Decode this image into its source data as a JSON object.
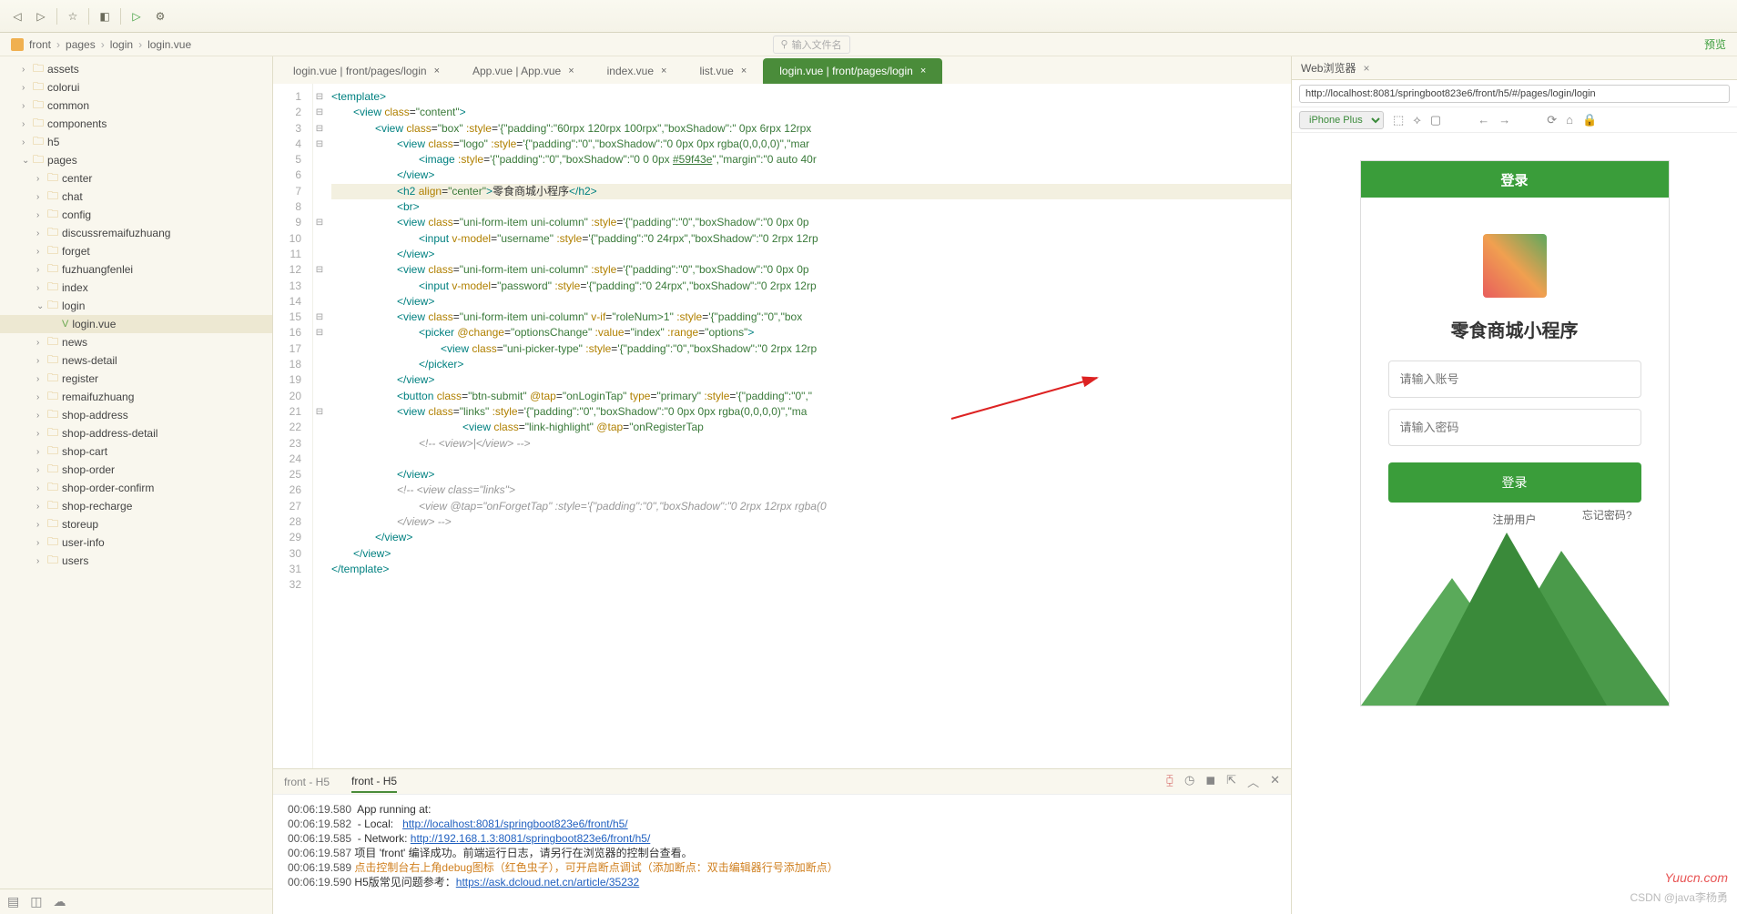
{
  "breadcrumb": {
    "proj": "front",
    "p1": "pages",
    "p2": "login",
    "p3": "login.vue",
    "search_placeholder": "输入文件名",
    "preview": "预览"
  },
  "sidebar": {
    "items": [
      {
        "label": "assets",
        "type": "folder",
        "indent": 1,
        "arrow": "›"
      },
      {
        "label": "colorui",
        "type": "folder",
        "indent": 1,
        "arrow": "›"
      },
      {
        "label": "common",
        "type": "folder",
        "indent": 1,
        "arrow": "›"
      },
      {
        "label": "components",
        "type": "folder",
        "indent": 1,
        "arrow": "›"
      },
      {
        "label": "h5",
        "type": "folder",
        "indent": 1,
        "arrow": "›"
      },
      {
        "label": "pages",
        "type": "folder",
        "indent": 1,
        "arrow": "⌄"
      },
      {
        "label": "center",
        "type": "folder",
        "indent": 2,
        "arrow": "›"
      },
      {
        "label": "chat",
        "type": "folder",
        "indent": 2,
        "arrow": "›"
      },
      {
        "label": "config",
        "type": "folder",
        "indent": 2,
        "arrow": "›"
      },
      {
        "label": "discussremaifuzhuang",
        "type": "folder",
        "indent": 2,
        "arrow": "›"
      },
      {
        "label": "forget",
        "type": "folder",
        "indent": 2,
        "arrow": "›"
      },
      {
        "label": "fuzhuangfenlei",
        "type": "folder",
        "indent": 2,
        "arrow": "›"
      },
      {
        "label": "index",
        "type": "folder",
        "indent": 2,
        "arrow": "›"
      },
      {
        "label": "login",
        "type": "folder",
        "indent": 2,
        "arrow": "⌄"
      },
      {
        "label": "login.vue",
        "type": "file",
        "indent": 3,
        "selected": true
      },
      {
        "label": "news",
        "type": "folder",
        "indent": 2,
        "arrow": "›"
      },
      {
        "label": "news-detail",
        "type": "folder",
        "indent": 2,
        "arrow": "›"
      },
      {
        "label": "register",
        "type": "folder",
        "indent": 2,
        "arrow": "›"
      },
      {
        "label": "remaifuzhuang",
        "type": "folder",
        "indent": 2,
        "arrow": "›"
      },
      {
        "label": "shop-address",
        "type": "folder",
        "indent": 2,
        "arrow": "›"
      },
      {
        "label": "shop-address-detail",
        "type": "folder",
        "indent": 2,
        "arrow": "›"
      },
      {
        "label": "shop-cart",
        "type": "folder",
        "indent": 2,
        "arrow": "›"
      },
      {
        "label": "shop-order",
        "type": "folder",
        "indent": 2,
        "arrow": "›"
      },
      {
        "label": "shop-order-confirm",
        "type": "folder",
        "indent": 2,
        "arrow": "›"
      },
      {
        "label": "shop-recharge",
        "type": "folder",
        "indent": 2,
        "arrow": "›"
      },
      {
        "label": "storeup",
        "type": "folder",
        "indent": 2,
        "arrow": "›"
      },
      {
        "label": "user-info",
        "type": "folder",
        "indent": 2,
        "arrow": "›"
      },
      {
        "label": "users",
        "type": "folder",
        "indent": 2,
        "arrow": "›"
      }
    ]
  },
  "tabs": [
    {
      "label": "login.vue | front/pages/login",
      "active": false
    },
    {
      "label": "App.vue | App.vue",
      "active": false
    },
    {
      "label": "index.vue",
      "active": false
    },
    {
      "label": "list.vue",
      "active": false
    },
    {
      "label": "login.vue | front/pages/login",
      "active": true
    }
  ],
  "code": {
    "lines": [
      {
        "n": 1,
        "f": "⊟",
        "i": 0,
        "html": "<span class='tag'>&lt;template&gt;</span>"
      },
      {
        "n": 2,
        "f": "⊟",
        "i": 1,
        "html": "<span class='tag'>&lt;view</span> <span class='attr'>class</span>=<span class='str'>\"content\"</span><span class='tag'>&gt;</span>"
      },
      {
        "n": 3,
        "f": "⊟",
        "i": 2,
        "html": "<span class='tag'>&lt;view</span> <span class='attr'>class</span>=<span class='str'>\"box\"</span> <span class='attr'>:style</span>=<span class='str'>'{\"padding\":\"60rpx 120rpx 100rpx\",\"boxShadow\":\" 0px 6rpx 12rpx</span>"
      },
      {
        "n": 4,
        "f": "⊟",
        "i": 3,
        "html": "<span class='tag'>&lt;view</span> <span class='attr'>class</span>=<span class='str'>\"logo\"</span> <span class='attr'>:style</span>=<span class='str'>'{\"padding\":\"0\",\"boxShadow\":\"0 0px 0px rgba(0,0,0,0)\",\"mar</span>"
      },
      {
        "n": 5,
        "f": "",
        "i": 4,
        "html": "<span class='tag'>&lt;image</span> <span class='attr'>:style</span>=<span class='str'>'{\"padding\":\"0\",\"boxShadow\":\"0 0 0px <u>#59f43e</u>\",\"margin\":\"0 auto 40r</span>"
      },
      {
        "n": 6,
        "f": "",
        "i": 3,
        "html": "<span class='tag'>&lt;/view&gt;</span>"
      },
      {
        "n": 7,
        "f": "",
        "i": 3,
        "hl": true,
        "html": "<span class='tag'>&lt;h2</span> <span class='attr'>align</span>=<span class='str'>\"center\"</span><span class='tag'>&gt;</span><span class='txt'>零食商城小程序</span><span class='tag'>&lt;/h2&gt;</span>"
      },
      {
        "n": 8,
        "f": "",
        "i": 3,
        "html": "<span class='tag'>&lt;br&gt;</span>"
      },
      {
        "n": 9,
        "f": "⊟",
        "i": 3,
        "html": "<span class='tag'>&lt;view</span> <span class='attr'>class</span>=<span class='str'>\"uni-form-item uni-column\"</span> <span class='attr'>:style</span>=<span class='str'>'{\"padding\":\"0\",\"boxShadow\":\"0 0px 0p</span>"
      },
      {
        "n": 10,
        "f": "",
        "i": 4,
        "html": "<span class='tag'>&lt;input</span> <span class='attr'>v-model</span>=<span class='str'>\"username\"</span> <span class='attr'>:style</span>=<span class='str'>'{\"padding\":\"0 24rpx\",\"boxShadow\":\"0 2rpx 12rp</span>"
      },
      {
        "n": 11,
        "f": "",
        "i": 3,
        "html": "<span class='tag'>&lt;/view&gt;</span>"
      },
      {
        "n": 12,
        "f": "⊟",
        "i": 3,
        "html": "<span class='tag'>&lt;view</span> <span class='attr'>class</span>=<span class='str'>\"uni-form-item uni-column\"</span> <span class='attr'>:style</span>=<span class='str'>'{\"padding\":\"0\",\"boxShadow\":\"0 0px 0p</span>"
      },
      {
        "n": 13,
        "f": "",
        "i": 4,
        "html": "<span class='tag'>&lt;input</span> <span class='attr'>v-model</span>=<span class='str'>\"password\"</span> <span class='attr'>:style</span>=<span class='str'>'{\"padding\":\"0 24rpx\",\"boxShadow\":\"0 2rpx 12rp</span>"
      },
      {
        "n": 14,
        "f": "",
        "i": 3,
        "html": "<span class='tag'>&lt;/view&gt;</span>"
      },
      {
        "n": 15,
        "f": "⊟",
        "i": 3,
        "html": "<span class='tag'>&lt;view</span> <span class='attr'>class</span>=<span class='str'>\"uni-form-item uni-column\"</span> <span class='attr'>v-if</span>=<span class='str'>\"roleNum&gt;1\"</span> <span class='attr'>:style</span>=<span class='str'>'{\"padding\":\"0\",\"box</span>"
      },
      {
        "n": 16,
        "f": "⊟",
        "i": 4,
        "html": "<span class='tag'>&lt;picker</span> <span class='attr'>@change</span>=<span class='str'>\"optionsChange\"</span> <span class='attr'>:value</span>=<span class='str'>\"index\"</span> <span class='attr'>:range</span>=<span class='str'>\"options\"</span><span class='tag'>&gt;</span>"
      },
      {
        "n": 17,
        "f": "",
        "i": 5,
        "html": "<span class='tag'>&lt;view</span> <span class='attr'>class</span>=<span class='str'>\"uni-picker-type\"</span> <span class='attr'>:style</span>=<span class='str'>'{\"padding\":\"0\",\"boxShadow\":\"0 2rpx 12rp</span>"
      },
      {
        "n": 18,
        "f": "",
        "i": 4,
        "html": "<span class='tag'>&lt;/picker&gt;</span>"
      },
      {
        "n": 19,
        "f": "",
        "i": 3,
        "html": "<span class='tag'>&lt;/view&gt;</span>"
      },
      {
        "n": 20,
        "f": "",
        "i": 3,
        "html": "<span class='tag'>&lt;button</span> <span class='attr'>class</span>=<span class='str'>\"btn-submit\"</span> <span class='attr'>@tap</span>=<span class='str'>\"onLoginTap\"</span> <span class='attr'>type</span>=<span class='str'>\"primary\"</span> <span class='attr'>:style</span>=<span class='str'>'{\"padding\":\"0\",\"</span>"
      },
      {
        "n": 21,
        "f": "⊟",
        "i": 3,
        "html": "<span class='tag'>&lt;view</span> <span class='attr'>class</span>=<span class='str'>\"links\"</span> <span class='attr'>:style</span>=<span class='str'>'{\"padding\":\"0\",\"boxShadow\":\"0 0px 0px rgba(0,0,0,0)\",\"ma</span>"
      },
      {
        "n": 22,
        "f": "",
        "i": 6,
        "html": "<span class='tag'>&lt;view</span> <span class='attr'>class</span>=<span class='str'>\"link-highlight\"</span> <span class='attr'>@tap</span>=<span class='str'>\"onRegisterTap</span>"
      },
      {
        "n": 23,
        "f": "",
        "i": 4,
        "html": "<span class='com'>&lt;!-- &lt;view&gt;|&lt;/view&gt; --&gt;</span>"
      },
      {
        "n": 24,
        "f": "",
        "i": 5,
        "html": ""
      },
      {
        "n": 25,
        "f": "",
        "i": 3,
        "html": "<span class='tag'>&lt;/view&gt;</span>"
      },
      {
        "n": 26,
        "f": "",
        "i": 3,
        "html": "<span class='com'>&lt;!-- &lt;view class=\"links\"&gt;</span>"
      },
      {
        "n": 27,
        "f": "",
        "i": 4,
        "html": "<span class='com'>&lt;view @tap=\"onForgetTap\" :style='{\"padding\":\"0\",\"boxShadow\":\"0 2rpx 12rpx rgba(0</span>"
      },
      {
        "n": 28,
        "f": "",
        "i": 3,
        "html": "<span class='com'>&lt;/view&gt; --&gt;</span>"
      },
      {
        "n": 29,
        "f": "",
        "i": 2,
        "html": "<span class='tag'>&lt;/view&gt;</span>"
      },
      {
        "n": 30,
        "f": "",
        "i": 1,
        "html": "<span class='tag'>&lt;/view&gt;</span>"
      },
      {
        "n": 31,
        "f": "",
        "i": 0,
        "html": "<span class='tag'>&lt;/template&gt;</span>"
      },
      {
        "n": 32,
        "f": "",
        "i": 0,
        "html": ""
      }
    ]
  },
  "terminal": {
    "tabs": [
      {
        "label": "front - H5",
        "active": false
      },
      {
        "label": "front - H5",
        "active": true
      }
    ],
    "lines": [
      {
        "ts": "00:06:19.580",
        "txt": "  App running at:"
      },
      {
        "ts": "00:06:19.582",
        "txt": "  - Local:   ",
        "link": "http://localhost:8081/springboot823e6/front/h5/"
      },
      {
        "ts": "00:06:19.585",
        "txt": "  - Network: ",
        "link": "http://192.168.1.3:8081/springboot823e6/front/h5/"
      },
      {
        "ts": "00:06:19.587",
        "txt": " 项目 'front' 编译成功。前端运行日志，请另行在浏览器的控制台查看。"
      },
      {
        "ts": "00:06:19.589",
        "tip": " 点击控制台右上角debug图标（红色虫子），可开启断点调试（添加断点：双击编辑器行号添加断点）"
      },
      {
        "ts": "00:06:19.590",
        "txt": " H5版常见问题参考：",
        "link": "https://ask.dcloud.net.cn/article/35232"
      }
    ]
  },
  "browser": {
    "tab": "Web浏览器",
    "url": "http://localhost:8081/springboot823e6/front/h5/#/pages/login/login",
    "device": "iPhone Plus",
    "phone": {
      "header": "登录",
      "title": "零食商城小程序",
      "username_ph": "请输入账号",
      "password_ph": "请输入密码",
      "login_btn": "登录",
      "register": "注册用户",
      "forget": "忘记密码?"
    }
  },
  "watermark": "Yuucn.com",
  "watermark2": "CSDN @java李杨勇"
}
